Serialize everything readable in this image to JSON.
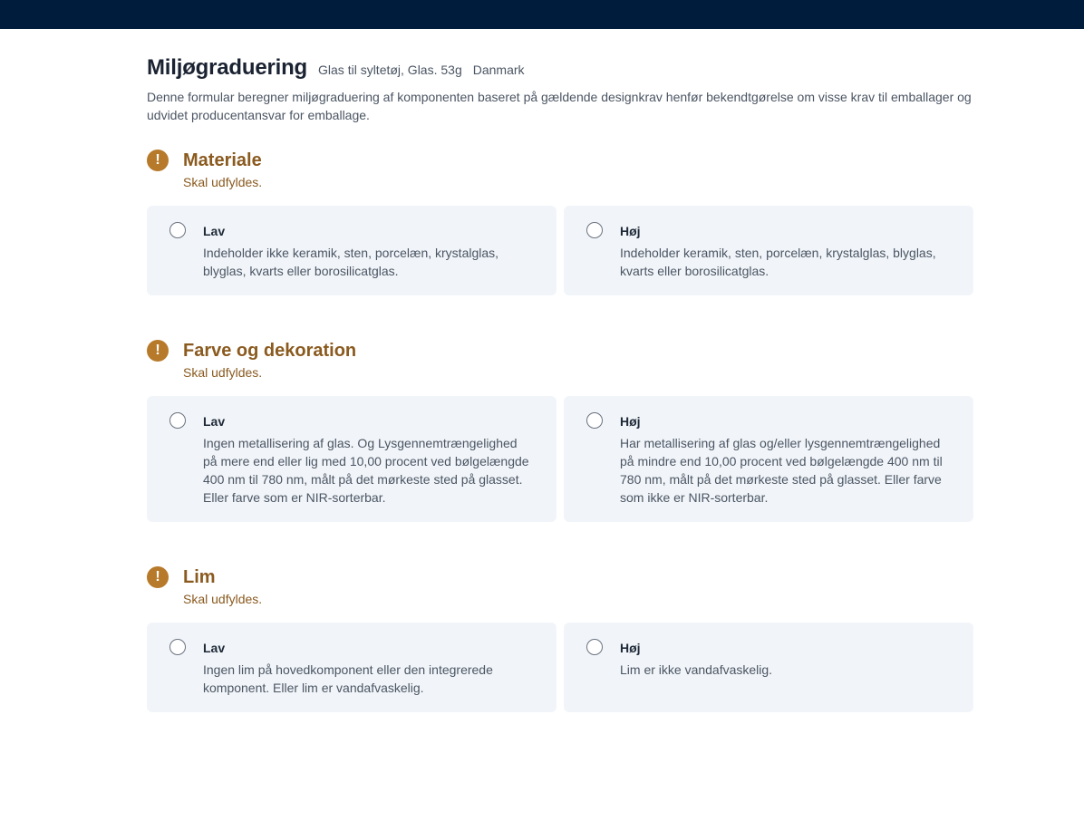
{
  "header": {
    "title": "Miljøgraduering",
    "subtitle": "Glas til syltetøj, Glas. 53g",
    "country": "Danmark",
    "description": "Denne formular beregner miljøgraduering af komponenten baseret på gældende designkrav henfør bekendtgørelse om visse krav til emballager og udvidet producentansvar for emballage."
  },
  "colors": {
    "topbar": "#001c3d",
    "warning": "#b7792a",
    "section_title": "#8a5a1f",
    "option_bg": "#f1f5f9"
  },
  "sections": [
    {
      "icon": "exclamation-icon",
      "title": "Materiale",
      "required": "Skal udfyldes.",
      "options": [
        {
          "label": "Lav",
          "description": "Indeholder ikke keramik, sten, porcelæn, krystalglas, blyglas, kvarts eller borosilicatglas."
        },
        {
          "label": "Høj",
          "description": "Indeholder keramik, sten, porcelæn, krystalglas, blyglas, kvarts eller borosilicatglas."
        }
      ]
    },
    {
      "icon": "exclamation-icon",
      "title": "Farve og dekoration",
      "required": "Skal udfyldes.",
      "options": [
        {
          "label": "Lav",
          "description": "Ingen metallisering af glas. Og Lysgennemtrængelighed på mere end eller lig med 10,00 procent ved bølgelængde 400 nm til 780 nm, målt på det mørkeste sted på glasset. Eller farve som er NIR-sorterbar."
        },
        {
          "label": "Høj",
          "description": "Har metallisering af glas og/eller lysgennemtrængelighed på mindre end 10,00 procent ved bølgelængde 400 nm til 780 nm, målt på det mørkeste sted på glasset. Eller farve som ikke er NIR-sorterbar."
        }
      ]
    },
    {
      "icon": "exclamation-icon",
      "title": "Lim",
      "required": "Skal udfyldes.",
      "options": [
        {
          "label": "Lav",
          "description": "Ingen lim på hovedkomponent eller den integrerede komponent. Eller lim er vandafvaskelig."
        },
        {
          "label": "Høj",
          "description": "Lim er ikke vandafvaskelig."
        }
      ]
    }
  ]
}
